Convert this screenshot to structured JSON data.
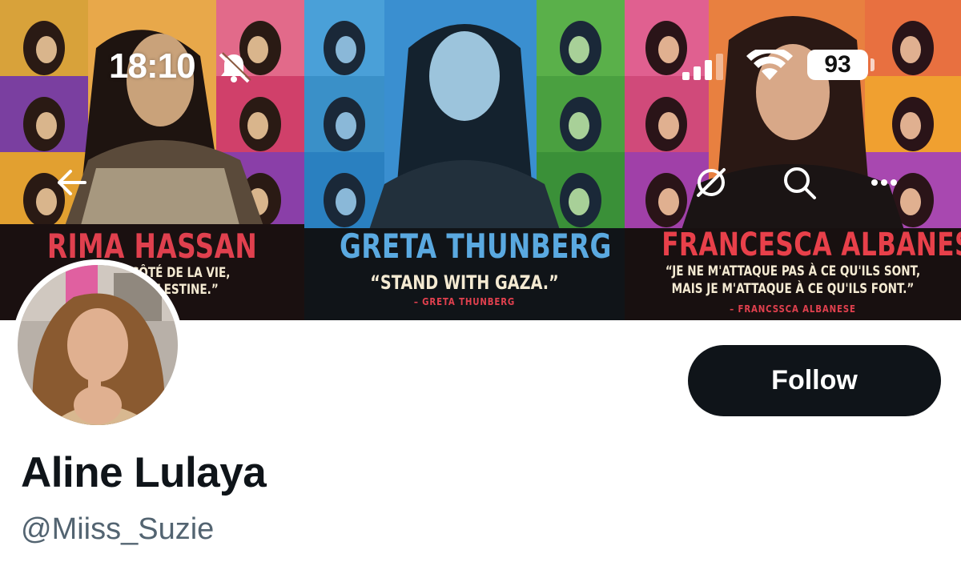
{
  "status_bar": {
    "time": "18:10",
    "battery": "93"
  },
  "banner": {
    "posters": [
      {
        "name": "RIMA HASSAN",
        "quote_line1": "“... S DU CÔTÉ DE LA VIE,",
        "quote_line2": "... DE LA PALESTINE.”",
        "attribution": "... SSAN",
        "name_color": "#e0404e"
      },
      {
        "name": "GRETA THUNBERG",
        "quote_line1": "“STAND WITH GAZA.”",
        "attribution": "– GRETA THUNBERG",
        "name_color": "#5aa9e0"
      },
      {
        "name": "FRANCESCA ALBANESE",
        "quote_line1": "“JE NE M'ATTAQUE PAS À CE QU'ILS SONT,",
        "quote_line2": "MAIS JE M'ATTAQUE À CE QU'ILS FONT.”",
        "attribution": "– FRANCSSCA ALBANESE",
        "name_color": "#e8404a"
      }
    ]
  },
  "nav": {
    "icons": [
      "back-arrow-icon",
      "grok-icon",
      "search-icon",
      "more-icon"
    ]
  },
  "profile": {
    "display_name": "Aline Lulaya",
    "handle": "@Miiss_Suzie",
    "follow_label": "Follow"
  },
  "colors": {
    "follow_bg": "#0f1419",
    "name_text": "#0f1419",
    "handle_text": "#536471"
  }
}
